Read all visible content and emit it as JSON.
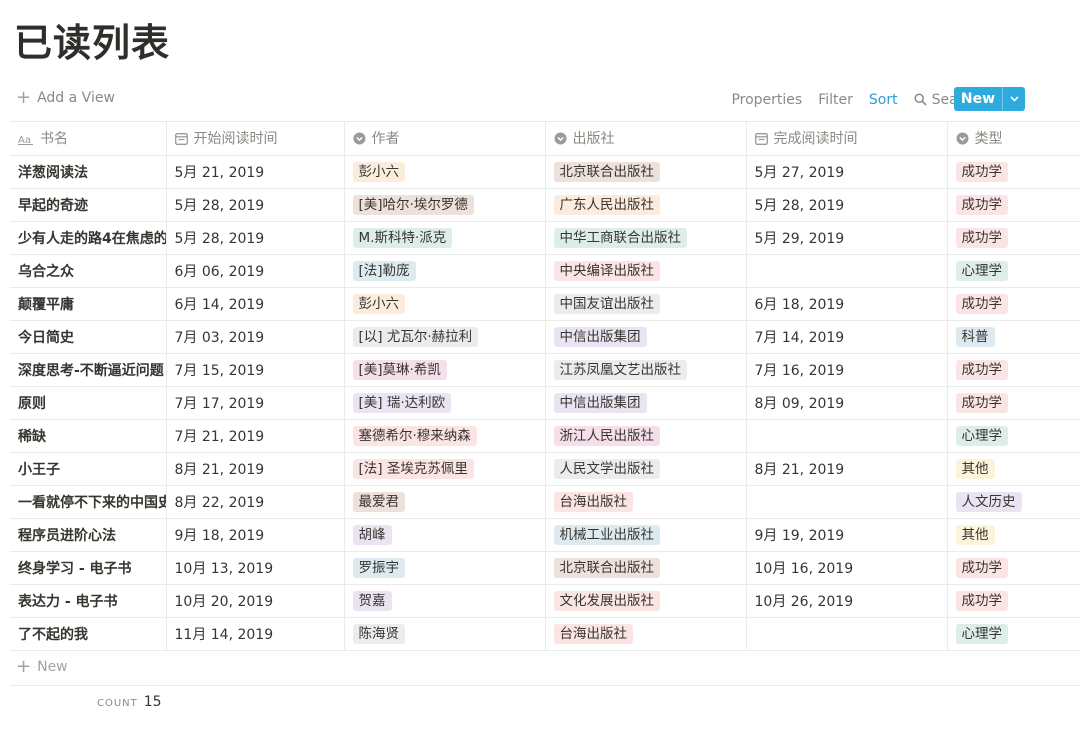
{
  "title": "已读列表",
  "view_bar": {
    "add_view": "Add a View",
    "properties": "Properties",
    "filter": "Filter",
    "sort": "Sort",
    "search": "Search",
    "more": "•••",
    "new": "New"
  },
  "columns": [
    {
      "label": "书名",
      "icon": "title-icon"
    },
    {
      "label": "开始阅读时间",
      "icon": "calendar-icon"
    },
    {
      "label": "作者",
      "icon": "select-icon"
    },
    {
      "label": "出版社",
      "icon": "select-icon"
    },
    {
      "label": "完成阅读时间",
      "icon": "calendar-icon"
    },
    {
      "label": "类型",
      "icon": "select-icon"
    }
  ],
  "tag_colors": {
    "orange": "#fbecdd",
    "brown": "#eee0da",
    "green": "#ddedea",
    "blue": "#ddebf1",
    "red": "#fbe4e4",
    "gray": "#ebeced",
    "purple": "#eae4f2",
    "pink": "#f4dfeb",
    "yellow": "#fbf3db"
  },
  "rows": [
    {
      "name": "洋葱阅读法",
      "start": "5月 21, 2019",
      "author": {
        "text": "彭小六",
        "color": "orange"
      },
      "publisher": {
        "text": "北京联合出版社",
        "color": "brown"
      },
      "finish": "5月 27, 2019",
      "type": {
        "text": "成功学",
        "color": "red"
      }
    },
    {
      "name": "早起的奇迹",
      "start": "5月 28, 2019",
      "author": {
        "text": "[美]哈尔·埃尔罗德",
        "color": "brown"
      },
      "publisher": {
        "text": "广东人民出版社",
        "color": "orange"
      },
      "finish": "5月 28, 2019",
      "type": {
        "text": "成功学",
        "color": "red"
      }
    },
    {
      "name": "少有人走的路4在焦虑的",
      "start": "5月 28, 2019",
      "author": {
        "text": "M.斯科特·派克",
        "color": "green"
      },
      "publisher": {
        "text": "中华工商联合出版社",
        "color": "green"
      },
      "finish": "5月 29, 2019",
      "type": {
        "text": "成功学",
        "color": "red"
      }
    },
    {
      "name": "乌合之众",
      "start": "6月 06, 2019",
      "author": {
        "text": "[法]勒庞",
        "color": "blue"
      },
      "publisher": {
        "text": "中央编译出版社",
        "color": "red"
      },
      "finish": "",
      "type": {
        "text": "心理学",
        "color": "green"
      }
    },
    {
      "name": "颠覆平庸",
      "start": "6月 14, 2019",
      "author": {
        "text": "彭小六",
        "color": "orange"
      },
      "publisher": {
        "text": "中国友谊出版社",
        "color": "gray"
      },
      "finish": "6月 18, 2019",
      "type": {
        "text": "成功学",
        "color": "red"
      }
    },
    {
      "name": "今日简史",
      "start": "7月 03, 2019",
      "author": {
        "text": "[以] 尤瓦尔·赫拉利",
        "color": "gray"
      },
      "publisher": {
        "text": "中信出版集团",
        "color": "purple"
      },
      "finish": "7月 14, 2019",
      "type": {
        "text": "科普",
        "color": "blue"
      }
    },
    {
      "name": "深度思考-不断逼近问题",
      "start": "7月 15, 2019",
      "author": {
        "text": "[美]莫琳·希凯",
        "color": "pink"
      },
      "publisher": {
        "text": "江苏凤凰文艺出版社",
        "color": "gray"
      },
      "finish": "7月 16, 2019",
      "type": {
        "text": "成功学",
        "color": "red"
      }
    },
    {
      "name": "原则",
      "start": "7月 17, 2019",
      "author": {
        "text": "[美] 瑞·达利欧",
        "color": "purple"
      },
      "publisher": {
        "text": "中信出版集团",
        "color": "purple"
      },
      "finish": "8月 09, 2019",
      "type": {
        "text": "成功学",
        "color": "red"
      }
    },
    {
      "name": "稀缺",
      "start": "7月 21, 2019",
      "author": {
        "text": "塞德希尔·穆来纳森",
        "color": "red"
      },
      "publisher": {
        "text": "浙江人民出版社",
        "color": "pink"
      },
      "finish": "",
      "type": {
        "text": "心理学",
        "color": "green"
      }
    },
    {
      "name": "小王子",
      "start": "8月 21, 2019",
      "author": {
        "text": "[法] 圣埃克苏佩里",
        "color": "red"
      },
      "publisher": {
        "text": "人民文学出版社",
        "color": "gray"
      },
      "finish": "8月 21, 2019",
      "type": {
        "text": "其他",
        "color": "yellow"
      }
    },
    {
      "name": "一看就停不下来的中国史",
      "start": "8月 22, 2019",
      "author": {
        "text": "最爱君",
        "color": "brown"
      },
      "publisher": {
        "text": "台海出版社",
        "color": "red"
      },
      "finish": "",
      "type": {
        "text": "人文历史",
        "color": "purple"
      }
    },
    {
      "name": "程序员进阶心法",
      "start": "9月 18, 2019",
      "author": {
        "text": "胡峰",
        "color": "purple"
      },
      "publisher": {
        "text": "机械工业出版社",
        "color": "blue"
      },
      "finish": "9月 19, 2019",
      "type": {
        "text": "其他",
        "color": "yellow"
      }
    },
    {
      "name": "终身学习 - 电子书",
      "start": "10月 13, 2019",
      "author": {
        "text": "罗振宇",
        "color": "blue"
      },
      "publisher": {
        "text": "北京联合出版社",
        "color": "brown"
      },
      "finish": "10月 16, 2019",
      "type": {
        "text": "成功学",
        "color": "red"
      }
    },
    {
      "name": "表达力 - 电子书",
      "start": "10月 20, 2019",
      "author": {
        "text": "贺嘉",
        "color": "purple"
      },
      "publisher": {
        "text": "文化发展出版社",
        "color": "red"
      },
      "finish": "10月 26, 2019",
      "type": {
        "text": "成功学",
        "color": "red"
      }
    },
    {
      "name": "了不起的我",
      "start": "11月 14, 2019",
      "author": {
        "text": "陈海贤",
        "color": "gray"
      },
      "publisher": {
        "text": "台海出版社",
        "color": "red"
      },
      "finish": "",
      "type": {
        "text": "心理学",
        "color": "green"
      }
    }
  ],
  "footer": {
    "new_row": "New",
    "count_label": "COUNT",
    "count_value": "15"
  }
}
